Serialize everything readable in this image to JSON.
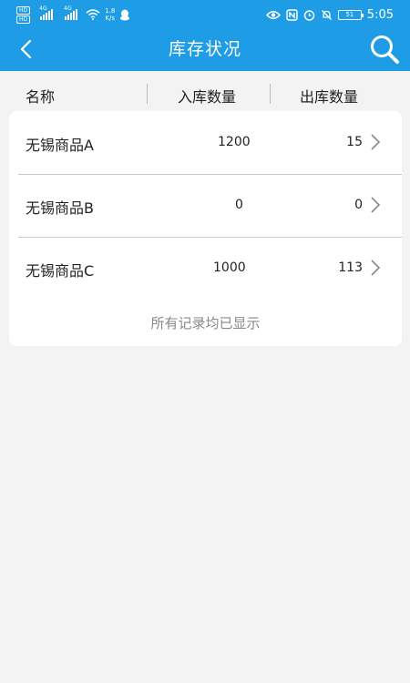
{
  "status_bar": {
    "network_badges": [
      "HD",
      "HD"
    ],
    "signal_labels": [
      "4G",
      "4G"
    ],
    "speed_value": "1.8",
    "speed_unit": "K/s",
    "battery": "51",
    "time": "5:05"
  },
  "app_bar": {
    "title": "库存状况"
  },
  "columns": {
    "name": "名称",
    "in_qty": "入库数量",
    "out_qty": "出库数量"
  },
  "rows": [
    {
      "name": "无锡商品A",
      "in_qty": "1200",
      "out_qty": "15"
    },
    {
      "name": "无锡商品B",
      "in_qty": "0",
      "out_qty": "0"
    },
    {
      "name": "无锡商品C",
      "in_qty": "1000",
      "out_qty": "113"
    }
  ],
  "footer_note": "所有记录均已显示",
  "icons": {
    "back": "chevron-left-icon",
    "search": "search-icon",
    "row_arrow": "chevron-right-icon"
  },
  "colors": {
    "primary": "#1e9de6",
    "background": "#f3f3f3",
    "card": "#ffffff",
    "muted_text": "#8a8a8a"
  }
}
